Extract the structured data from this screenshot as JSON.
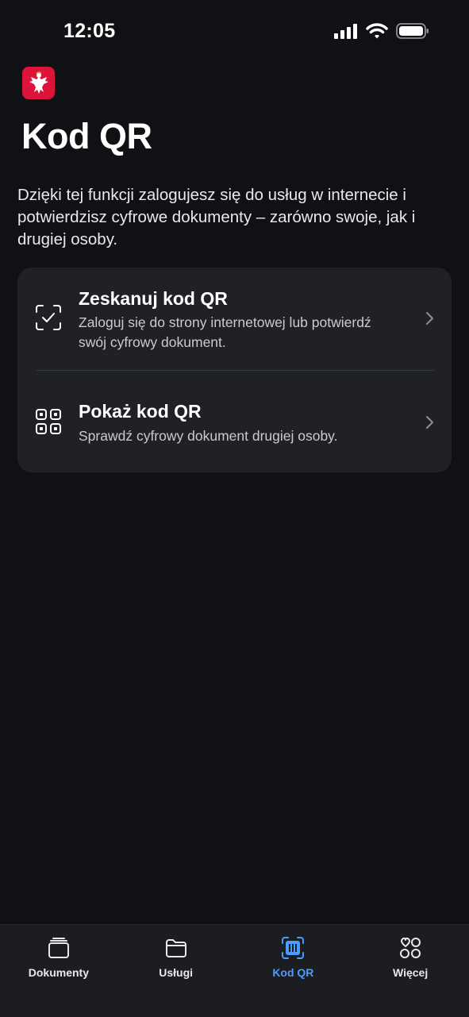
{
  "status_bar": {
    "time": "12:05"
  },
  "header": {
    "logo_icon": "polish-eagle-icon",
    "title": "Kod QR"
  },
  "intro": {
    "text": "Dzięki tej funkcji zalogujesz się do usług w internecie i potwierdzisz cyfrowe dokumenty – zarówno swoje, jak i drugiej osoby."
  },
  "options": [
    {
      "icon": "scan-check-icon",
      "title": "Zeskanuj kod QR",
      "description": "Zaloguj się do strony internetowej lub potwierdź swój cyfrowy dokument."
    },
    {
      "icon": "qr-code-icon",
      "title": "Pokaż kod QR",
      "description": "Sprawdź cyfrowy dokument drugiej osoby."
    }
  ],
  "tabbar": {
    "active": "Kod QR",
    "tabs": [
      {
        "label": "Dokumenty",
        "icon": "documents-stack-icon"
      },
      {
        "label": "Usługi",
        "icon": "folder-icon"
      },
      {
        "label": "Kod QR",
        "icon": "qr-scanner-icon"
      },
      {
        "label": "Więcej",
        "icon": "more-grid-icon"
      }
    ]
  },
  "colors": {
    "background": "#0f1114",
    "card": "#1f2126",
    "accent": "#4c9bff",
    "logo": "#dc143c"
  }
}
